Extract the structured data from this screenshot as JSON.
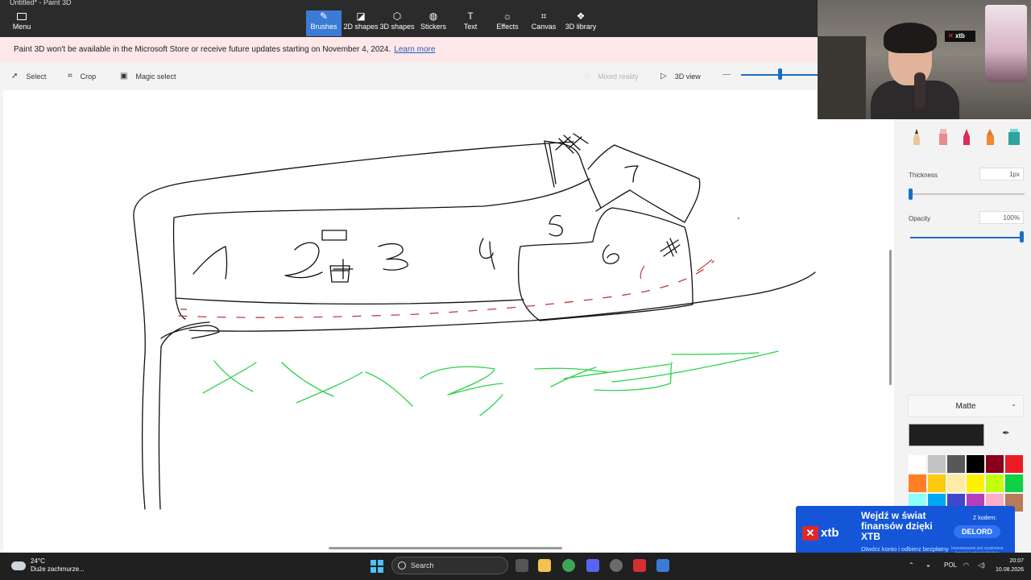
{
  "app": {
    "title": "Untitled* - Paint 3D",
    "menu_label": "Menu"
  },
  "toolbar": {
    "tools": [
      {
        "label": "Brushes",
        "icon": "brush-icon",
        "active": true
      },
      {
        "label": "2D shapes",
        "icon": "2d-shapes-icon",
        "active": false
      },
      {
        "label": "3D shapes",
        "icon": "3d-shapes-icon",
        "active": false
      },
      {
        "label": "Stickers",
        "icon": "stickers-icon",
        "active": false
      },
      {
        "label": "Text",
        "icon": "text-icon",
        "active": false
      },
      {
        "label": "Effects",
        "icon": "effects-icon",
        "active": false
      },
      {
        "label": "Canvas",
        "icon": "canvas-icon",
        "active": false
      },
      {
        "label": "3D library",
        "icon": "3d-library-icon",
        "active": false
      }
    ],
    "accent": "#3b7bd6"
  },
  "notice": {
    "text": "Paint 3D won't be available in the Microsoft Store or receive future updates starting on November 4, 2024.",
    "link": "Learn more"
  },
  "subbar": {
    "select": "Select",
    "crop": "Crop",
    "magic_select": "Magic select",
    "mixed_reality": "Mixed reality",
    "view3d": "3D view"
  },
  "panel": {
    "thickness_label": "Thickness",
    "thickness_value": "1px",
    "opacity_label": "Opacity",
    "opacity_value": "100%",
    "opacity_fraction": 1.0,
    "material": "Matte",
    "selected_color": "#1f1f1f",
    "palette": [
      "#ffffff",
      "#c3c3c3",
      "#585858",
      "#000000",
      "#88001b",
      "#ec1c24",
      "#ff7f27",
      "#ffc90e",
      "#fdeca6",
      "#fff200",
      "#c4ff0e",
      "#0ed145",
      "#8cfffb",
      "#00a8f3",
      "#3f48cc",
      "#b83dba",
      "#ffaec8",
      "#b97a57"
    ]
  },
  "ad": {
    "headline": "Wejdź w świat finansów dzięki XTB",
    "sub": "Otwórz konto i odbierz bezpłatny kurs",
    "code_label": "Z kodem:",
    "code": "DELORD",
    "brand": "xtb",
    "small_print": "Inwestowanie jest ryzykowne. Inwestuj odpowiedzialnie."
  },
  "webcam": {
    "sign_brand": "xtb"
  },
  "taskbar": {
    "temperature": "24°C",
    "weather": "Duże zachmurze...",
    "search_placeholder": "Search",
    "lang": "POL",
    "time": "20:07",
    "date": "10.08.2026"
  }
}
